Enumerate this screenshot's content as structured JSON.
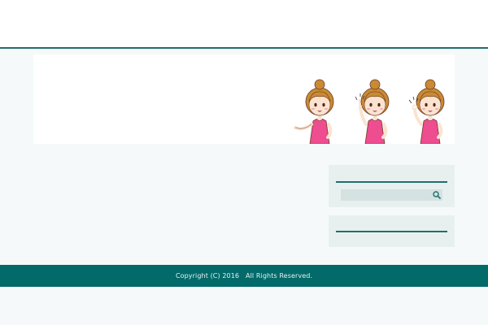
{
  "header": {},
  "banner": {
    "illustration": "three-girls-pink-shirts"
  },
  "sidebar": {
    "search": {
      "value": "",
      "placeholder": "",
      "icon": "search-icon"
    }
  },
  "footer": {
    "copyright": "Copyright (C) 2016   All Rights Reserved."
  },
  "colors": {
    "accent": "#1f6f6b",
    "footer_bg": "#036a6a",
    "page_bg": "#f5f9f9",
    "widget_bg": "#e8f0ef",
    "shirt": "#ee4d8f",
    "hair": "#c98a33"
  }
}
